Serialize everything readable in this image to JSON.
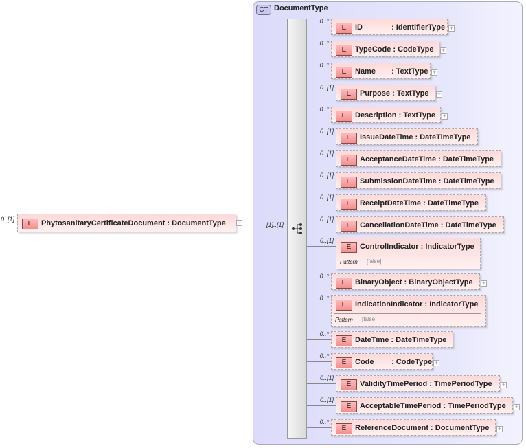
{
  "root": {
    "multiplicity": "0..[1]",
    "badge": "E",
    "name": "PhytosanitaryCertificateDocument",
    "type": ": DocumentType",
    "expand": "collapse"
  },
  "complex_type": {
    "badge": "CT",
    "name": "DocumentType",
    "sequence_multiplicity": "[1]..[1]"
  },
  "children": [
    {
      "multiplicity": "0..*",
      "name": "ID",
      "type": ": IdentifierType",
      "expandable": true
    },
    {
      "multiplicity": "0..*",
      "name": "TypeCode",
      "type": ": CodeType",
      "expandable": true
    },
    {
      "multiplicity": "0..*",
      "name": "Name",
      "type": ": TextType",
      "expandable": true
    },
    {
      "multiplicity": "0..[1]",
      "name": "Purpose",
      "type": ": TextType",
      "expandable": true
    },
    {
      "multiplicity": "0..*",
      "name": "Description",
      "type": ": TextType",
      "expandable": true
    },
    {
      "multiplicity": "0..[1]",
      "name": "IssueDateTime",
      "type": ": DateTimeType",
      "expandable": false
    },
    {
      "multiplicity": "0..[1]",
      "name": "AcceptanceDateTime",
      "type": ": DateTimeType",
      "expandable": false
    },
    {
      "multiplicity": "0..[1]",
      "name": "SubmissionDateTime",
      "type": ": DateTimeType",
      "expandable": false
    },
    {
      "multiplicity": "0..[1]",
      "name": "ReceiptDateTime",
      "type": ": DateTimeType",
      "expandable": false
    },
    {
      "multiplicity": "0..[1]",
      "name": "CancellationDateTime",
      "type": ": DateTimeType",
      "expandable": false
    },
    {
      "multiplicity": "0..[1]",
      "name": "ControlIndicator",
      "type": ": IndicatorType",
      "expandable": false,
      "facet": "Pattern",
      "facet_value": "[false]"
    },
    {
      "multiplicity": "0..*",
      "name": "BinaryObject",
      "type": ": BinaryObjectType",
      "expandable": true
    },
    {
      "multiplicity": "0..*",
      "name": "IndicationIndicator",
      "type": ": IndicatorType",
      "expandable": false,
      "facet": "Pattern",
      "facet_value": "[false]"
    },
    {
      "multiplicity": "0..*",
      "name": "DateTime",
      "type": ": DateTimeType",
      "expandable": false
    },
    {
      "multiplicity": "0..*",
      "name": "Code",
      "type": ": CodeType",
      "expandable": true
    },
    {
      "multiplicity": "0..[1]",
      "name": "ValidityTimePeriod",
      "type": ": TimePeriodType",
      "expandable": true
    },
    {
      "multiplicity": "0..[1]",
      "name": "AcceptableTimePeriod",
      "type": ": TimePeriodType",
      "expandable": true
    },
    {
      "multiplicity": "0..*",
      "name": "ReferenceDocument",
      "type": ": DocumentType",
      "expandable": true
    }
  ],
  "colors": {
    "element_fill": "#ffd9d9",
    "complex_type_fill": "#e0e0fb",
    "badge": "#f28f8f"
  }
}
